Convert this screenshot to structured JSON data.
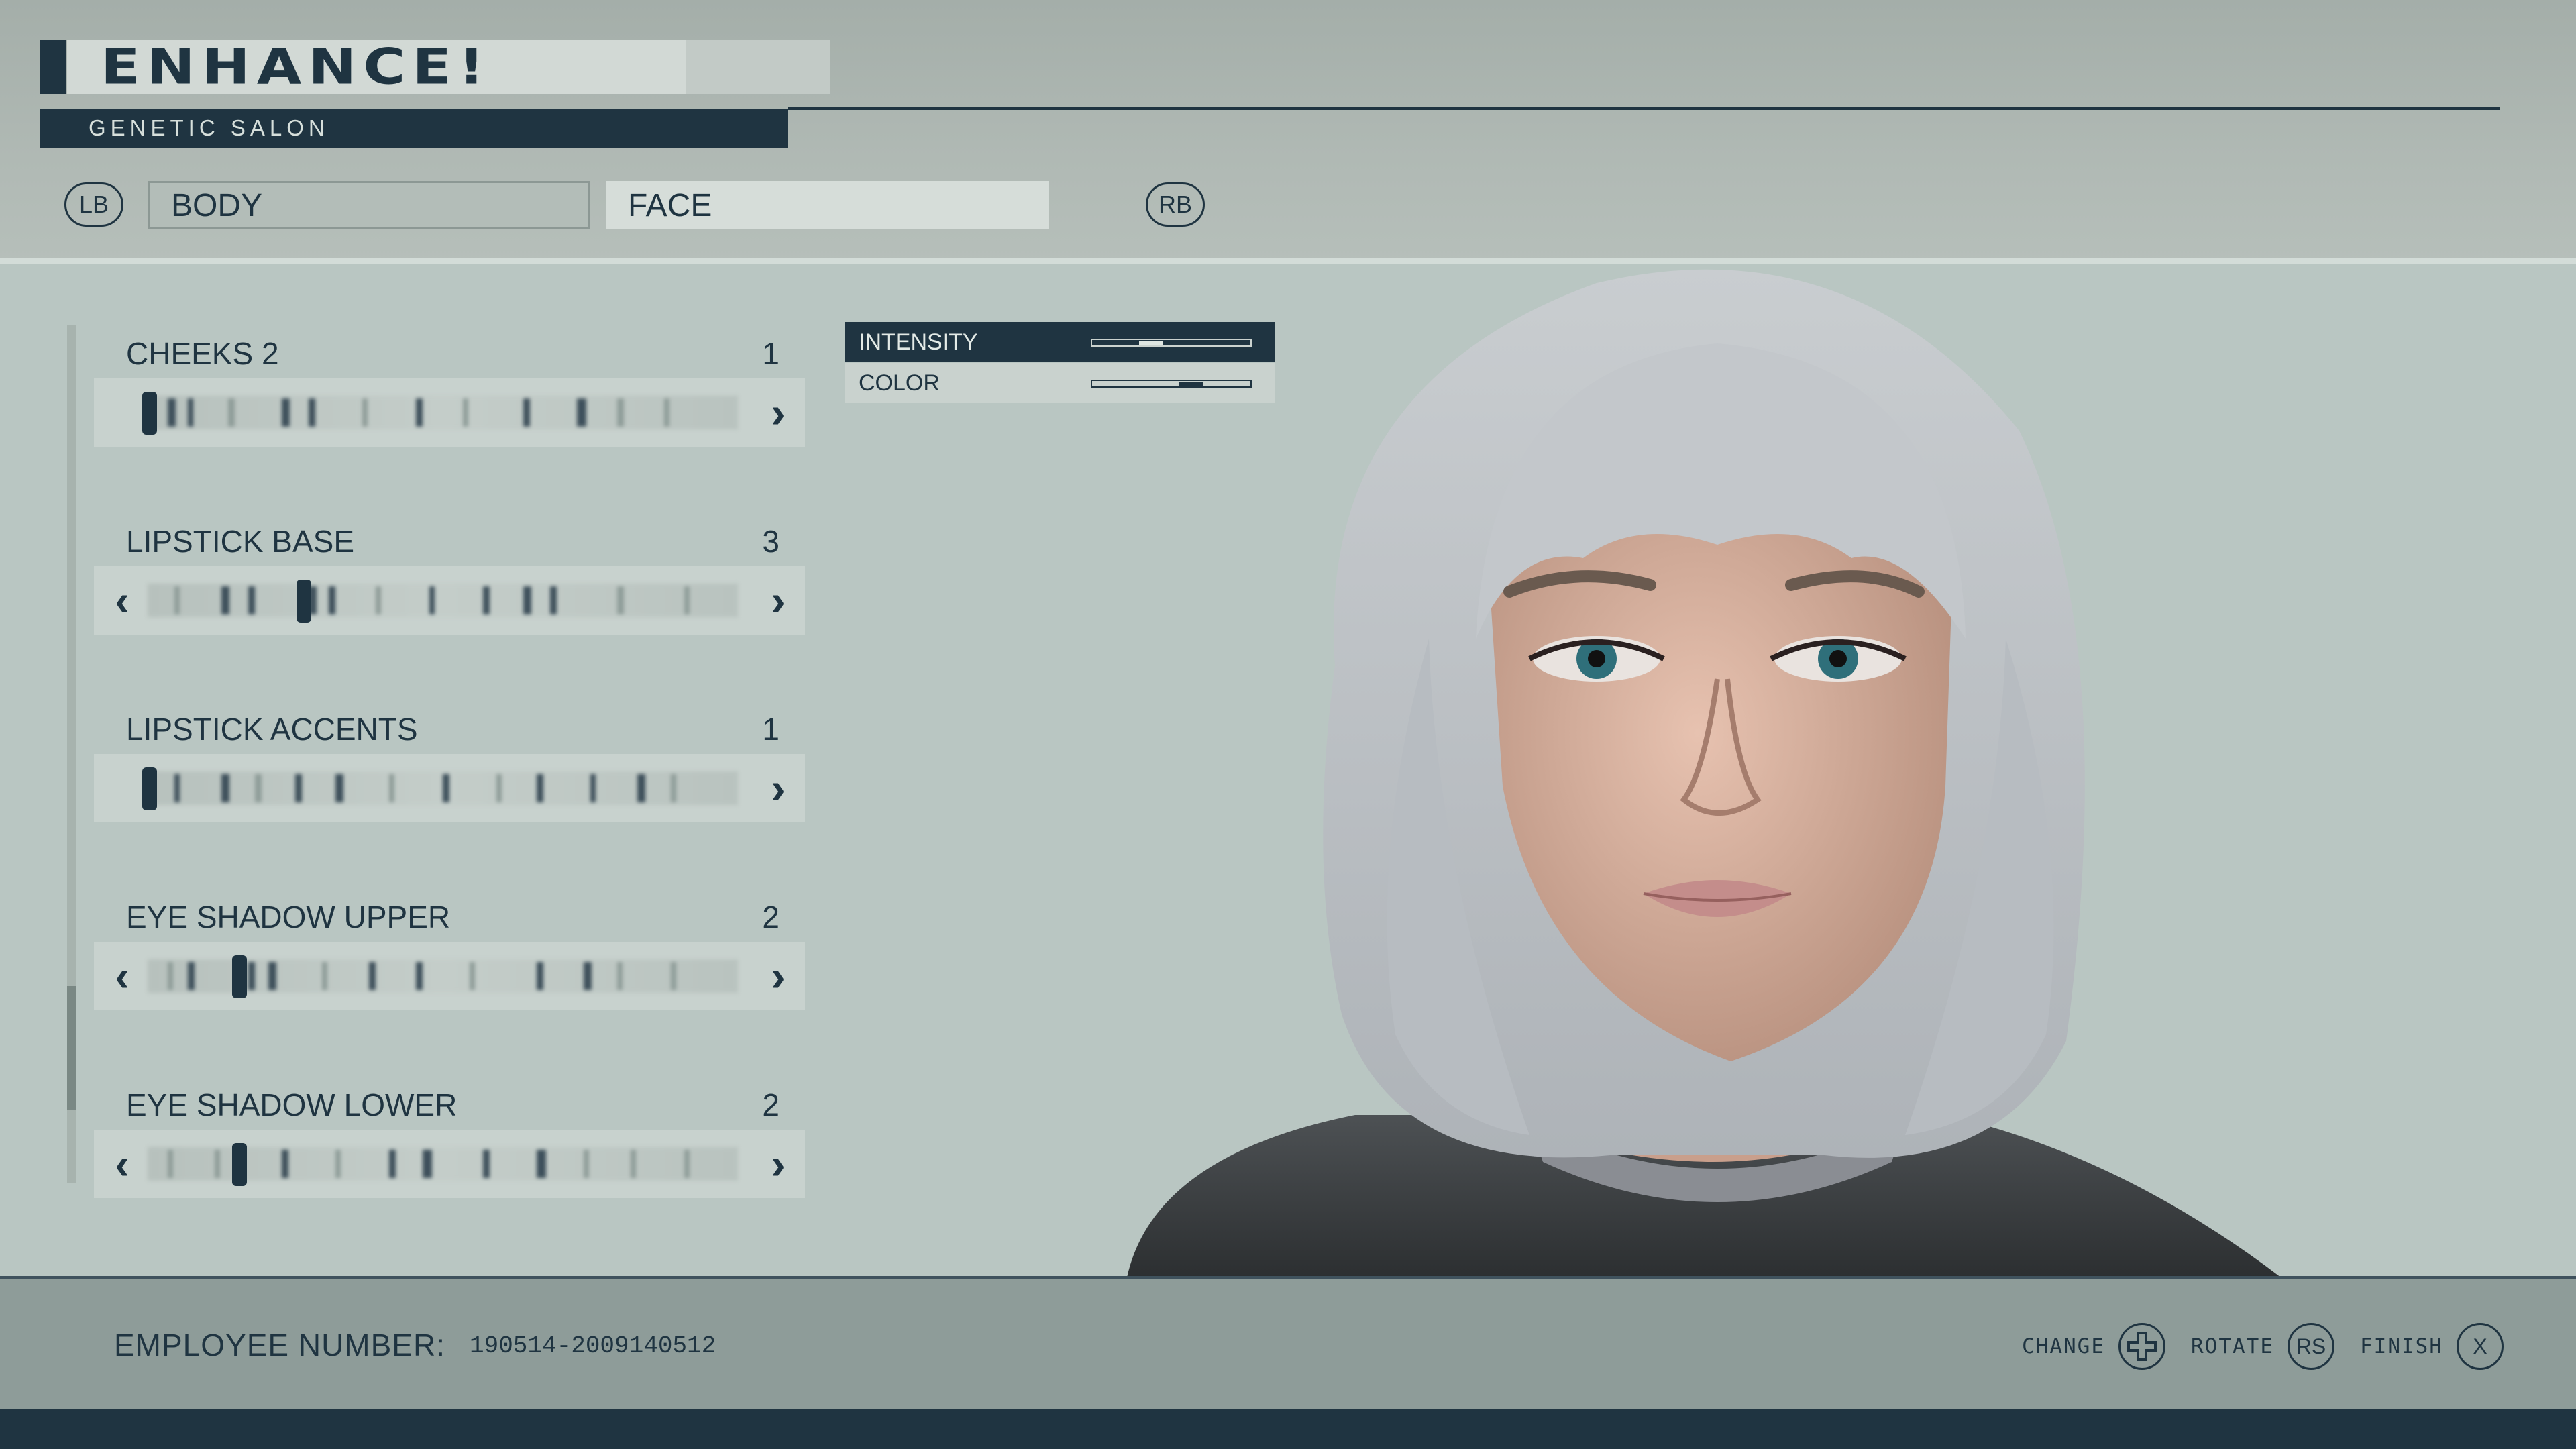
{
  "header": {
    "logo_text": "ENHANCE!",
    "subtitle": "GENETIC SALON"
  },
  "tabs": {
    "lb": "LB",
    "body": "BODY",
    "face": "FACE",
    "rb": "RB"
  },
  "sliders": [
    {
      "label": "CHEEKS 2",
      "value": "1"
    },
    {
      "label": "LIPSTICK BASE",
      "value": "3"
    },
    {
      "label": "LIPSTICK ACCENTS",
      "value": "1"
    },
    {
      "label": "EYE SHADOW UPPER",
      "value": "2"
    },
    {
      "label": "EYE SHADOW LOWER",
      "value": "2"
    }
  ],
  "sub_panel": {
    "intensity_label": "INTENSITY",
    "intensity_level": 0.35,
    "color_label": "COLOR",
    "color_level": 0.65
  },
  "footer": {
    "employee_label": "EMPLOYEE NUMBER:",
    "employee_number": "190514-2009140512",
    "change_label": "CHANGE",
    "rotate_label": "ROTATE",
    "rotate_button": "RS",
    "finish_label": "FINISH",
    "finish_button": "X"
  },
  "colors": {
    "accent": "#1f3441",
    "panel": "#b9c6c2",
    "hair": "#c8cbce"
  }
}
